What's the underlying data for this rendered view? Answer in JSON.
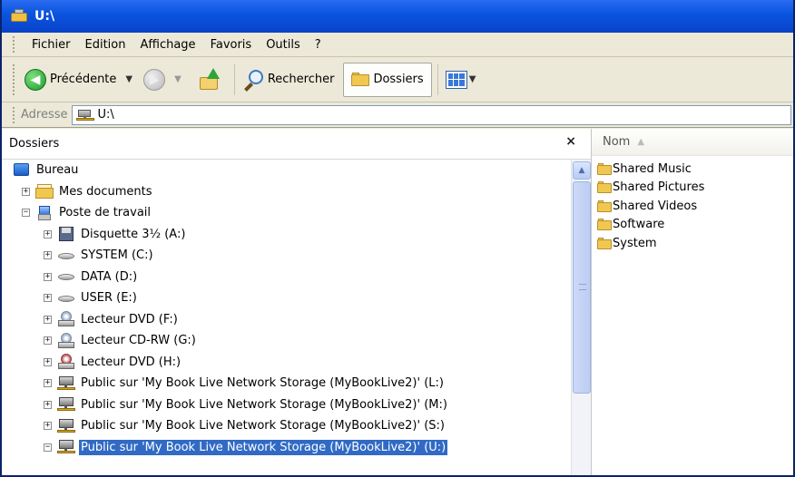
{
  "window": {
    "title": "U:\\"
  },
  "menu": [
    "Fichier",
    "Edition",
    "Affichage",
    "Favoris",
    "Outils",
    "?"
  ],
  "toolbar": {
    "back_label": "Précédente",
    "search_label": "Rechercher",
    "folders_label": "Dossiers"
  },
  "address": {
    "label": "Adresse",
    "value": "U:\\"
  },
  "folders_pane": {
    "title": "Dossiers",
    "close_glyph": "×"
  },
  "tree": {
    "bureau": "Bureau",
    "mes_documents": "Mes documents",
    "poste_de_travail": "Poste de travail",
    "drives": [
      "Disquette 3½ (A:)",
      "SYSTEM (C:)",
      "DATA (D:)",
      "USER (E:)",
      "Lecteur DVD (F:)",
      "Lecteur CD-RW (G:)",
      "Lecteur DVD (H:)",
      "Public sur 'My Book Live Network Storage (MyBookLive2)' (L:)",
      "Public sur 'My Book Live Network Storage (MyBookLive2)' (M:)",
      "Public sur 'My Book Live Network Storage (MyBookLive2)' (S:)",
      "Public sur 'My Book Live Network Storage (MyBookLive2)' (U:)"
    ]
  },
  "file_view": {
    "column_name": "Nom",
    "items": [
      "Shared Music",
      "Shared Pictures",
      "Shared Videos",
      "Software",
      "System"
    ]
  },
  "colors": {
    "titlebar": "#0b55e0",
    "selection": "#316ac5",
    "chrome": "#ece9d8"
  }
}
